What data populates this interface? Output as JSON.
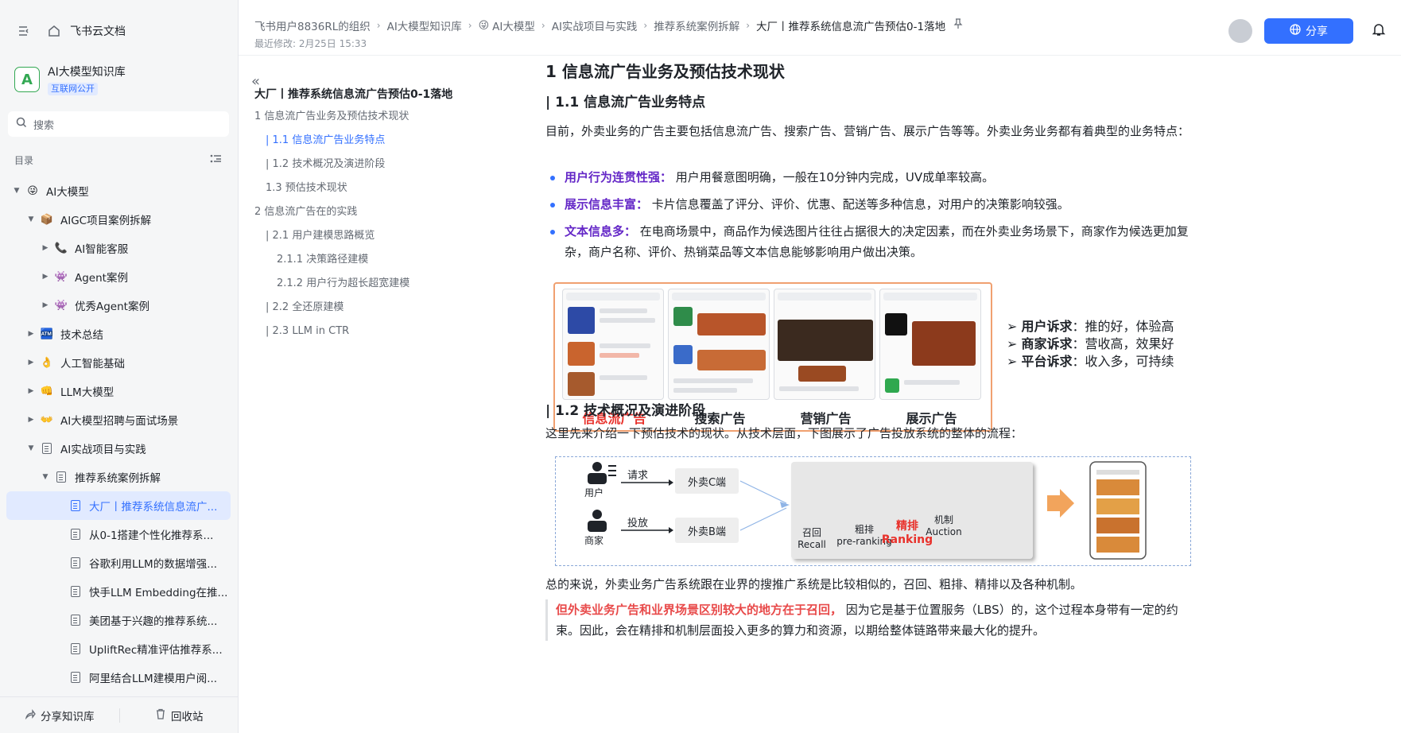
{
  "app": {
    "name": "飞书云文档"
  },
  "knowledge_base": {
    "name": "AI大模型知识库",
    "badge": "互联网公开",
    "logo_letter": "A"
  },
  "search": {
    "placeholder": "搜索"
  },
  "sidebar": {
    "toc_label": "目录",
    "tree": [
      {
        "label": "AI大模型",
        "level": 0,
        "icon": "😜",
        "caret": "▼"
      },
      {
        "label": "AIGC项目案例拆解",
        "level": 1,
        "icon": "📦",
        "caret": "▼"
      },
      {
        "label": "AI智能客服",
        "level": 2,
        "icon": "📞",
        "caret": "▶"
      },
      {
        "label": "Agent案例",
        "level": 2,
        "icon": "👾",
        "caret": "▶"
      },
      {
        "label": "优秀Agent案例",
        "level": 2,
        "icon": "👾",
        "caret": "▶"
      },
      {
        "label": "技术总结",
        "level": 1,
        "icon": "🏧",
        "caret": "▶"
      },
      {
        "label": "人工智能基础",
        "level": 1,
        "icon": "👌",
        "caret": "▶"
      },
      {
        "label": "LLM大模型",
        "level": 1,
        "icon": "👊",
        "caret": "▶"
      },
      {
        "label": "AI大模型招聘与面试场景",
        "level": 1,
        "icon": "👐",
        "caret": "▶"
      },
      {
        "label": "AI实战项目与实践",
        "level": 1,
        "icon": "doc",
        "caret": "▼"
      },
      {
        "label": "推荐系统案例拆解",
        "level": 2,
        "icon": "doc",
        "caret": "▼"
      },
      {
        "label": "大厂丨推荐系统信息流广...",
        "level": 3,
        "icon": "doc",
        "caret": "",
        "active": true
      },
      {
        "label": "从0-1搭建个性化推荐系...",
        "level": 3,
        "icon": "doc",
        "caret": ""
      },
      {
        "label": "谷歌利用LLM的数据增强...",
        "level": 3,
        "icon": "doc",
        "caret": ""
      },
      {
        "label": "快手LLM Embedding在推...",
        "level": 3,
        "icon": "doc",
        "caret": ""
      },
      {
        "label": "美团基于兴趣的推荐系统...",
        "level": 3,
        "icon": "doc",
        "caret": ""
      },
      {
        "label": "UpliftRec精准评估推荐系...",
        "level": 3,
        "icon": "doc",
        "caret": ""
      },
      {
        "label": "阿里结合LLM建模用户阅...",
        "level": 3,
        "icon": "doc",
        "caret": ""
      }
    ],
    "bottom": {
      "share_kb": "分享知识库",
      "recycle": "回收站"
    }
  },
  "header": {
    "breadcrumbs": [
      "飞书用户8836RL的组织",
      "AI大模型知识库",
      "AI大模型",
      "AI实战项目与实践",
      "推荐系统案例拆解",
      "大厂丨推荐系统信息流广告预估0-1落地"
    ],
    "breadcrumb_emoji": "😜",
    "last_modified": "最近修改: 2月25日 15:33",
    "share_label": "分享"
  },
  "outline": {
    "title": "大厂丨推荐系统信息流广告预估0-1落地",
    "items": [
      {
        "label": "1 信息流广告业务及预估技术现状",
        "level": 1
      },
      {
        "label": "| 1.1 信息流广告业务特点",
        "level": 2,
        "active": true
      },
      {
        "label": "| 1.2 技术概况及演进阶段",
        "level": 2
      },
      {
        "label": "1.3 预估技术现状",
        "level": 2
      },
      {
        "label": "2 信息流广告在的实践",
        "level": 1
      },
      {
        "label": "| 2.1 用户建模思路概览",
        "level": 2
      },
      {
        "label": "2.1.1 决策路径建模",
        "level": 3
      },
      {
        "label": "2.1.2 用户行为超长超宽建模",
        "level": 3
      },
      {
        "label": "| 2.2 全还原建模",
        "level": 2
      },
      {
        "label": "| 2.3 LLM in CTR",
        "level": 2
      }
    ]
  },
  "doc": {
    "h1": "1 信息流广告业务及预估技术现状",
    "h2_1": "| 1.1 信息流广告业务特点",
    "p1": "目前，外卖业务的广告主要包括信息流广告、搜索广告、营销广告、展示广告等等。外卖业务业务都有着典型的业务特点：",
    "bullets": [
      {
        "label": "用户行为连贯性强：",
        "text": " 用户用餐意图明确，一般在10分钟内完成，UV成单率较高。"
      },
      {
        "label": "展示信息丰富：",
        "text": " 卡片信息覆盖了评分、评价、优惠、配送等多种信息，对用户的决策影响较强。"
      },
      {
        "label": "文本信息多：",
        "text": " 在电商场景中，商品作为候选图片往往占据很大的决定因素，而在外卖业务场景下，商家作为候选更加复杂，商户名称、评价、热销菜品等文本信息能够影响用户做出决策。"
      }
    ],
    "figure1": {
      "captions": [
        "信息流广告",
        "搜索广告",
        "营销广告",
        "展示广告"
      ],
      "claims": [
        {
          "label": "用户诉求",
          "text": "：推的好，体验高"
        },
        {
          "label": "商家诉求",
          "text": "：营收高，效果好"
        },
        {
          "label": "平台诉求",
          "text": "：收入多，可持续"
        }
      ]
    },
    "h2_2": "| 1.2 技术概况及演进阶段",
    "p2": "这里先来介绍一下预估技术的现状。从技术层面，下图展示了广告投放系统的整体的流程：",
    "figure2": {
      "user": "用户",
      "merchant": "商家",
      "request": "请求",
      "deliver": "投放",
      "c_end": "外卖C端",
      "b_end": "外卖B端",
      "recall_cn": "召回",
      "recall_en": "Recall",
      "pre_cn": "粗排",
      "pre_en": "pre-ranking",
      "rank_cn": "精排",
      "rank_en": "Ranking",
      "mech_cn": "机制",
      "mech_en": "Auction"
    },
    "p3": "总的来说，外卖业务广告系统跟在业界的搜推广系统是比较相似的，召回、粗排、精排以及各种机制。",
    "callout_red": "但外卖业务广告和业界场景区别较大的地方在于召回，",
    "callout_text": " 因为它是基于位置服务（LBS）的，这个过程本身带有一定的约束。因此，会在精排和机制层面投入更多的算力和资源，以期给整体链路带来最大化的提升。"
  },
  "colors": {
    "accent": "#3370ff",
    "highlight_purple": "#6427c7",
    "highlight_red": "#e84a4a"
  }
}
